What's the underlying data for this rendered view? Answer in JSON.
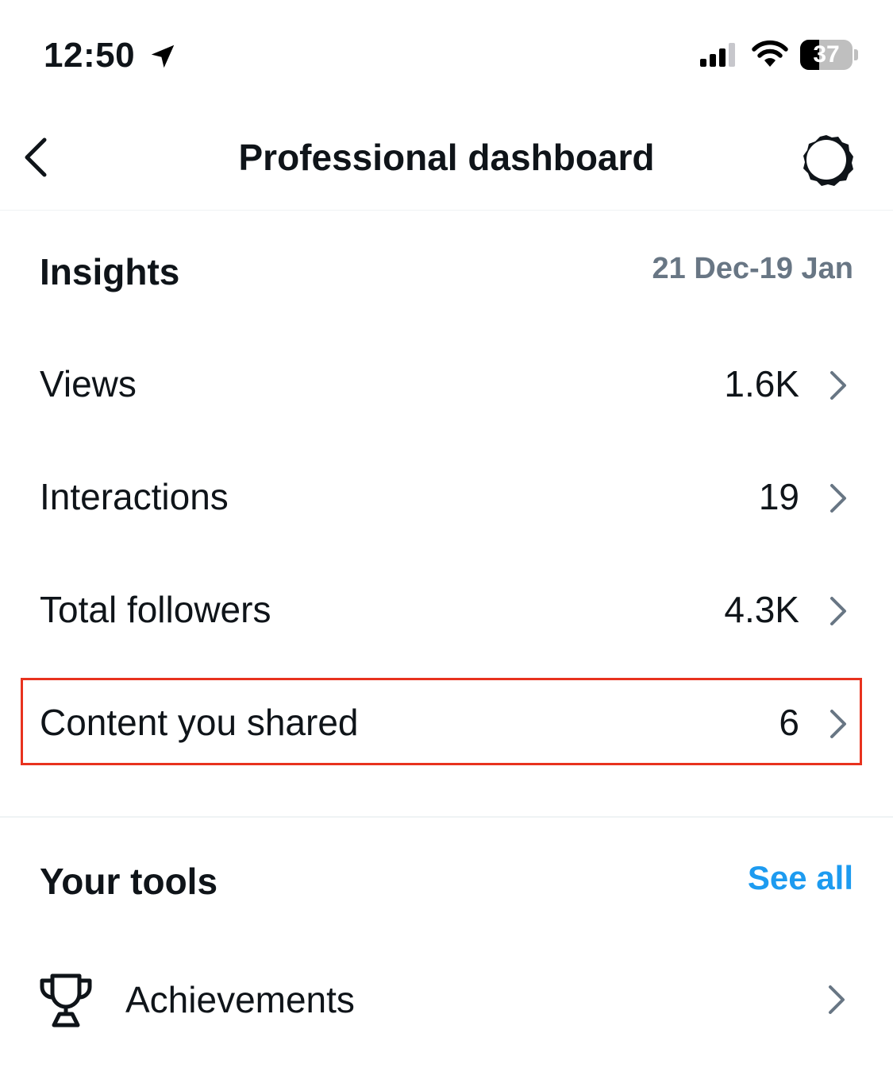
{
  "status_bar": {
    "time": "12:50",
    "battery_level": "37",
    "battery_fraction": 0.37
  },
  "header": {
    "title": "Professional dashboard",
    "back_icon": "chevron-left-icon",
    "settings_icon": "gear-icon"
  },
  "insights": {
    "title": "Insights",
    "date_range": "21 Dec-19 Jan",
    "rows": [
      {
        "label": "Views",
        "value": "1.6K"
      },
      {
        "label": "Interactions",
        "value": "19"
      },
      {
        "label": "Total followers",
        "value": "4.3K"
      },
      {
        "label": "Content you shared",
        "value": "6",
        "highlighted": true
      }
    ]
  },
  "tools": {
    "title": "Your tools",
    "see_all_label": "See all",
    "items": [
      {
        "label": "Achievements",
        "icon": "trophy-icon"
      }
    ]
  },
  "colors": {
    "text_primary": "#0f1419",
    "text_secondary": "#687684",
    "link_blue": "#1d9bf0",
    "highlight_red": "#e8321e",
    "divider": "#eff3f4"
  }
}
